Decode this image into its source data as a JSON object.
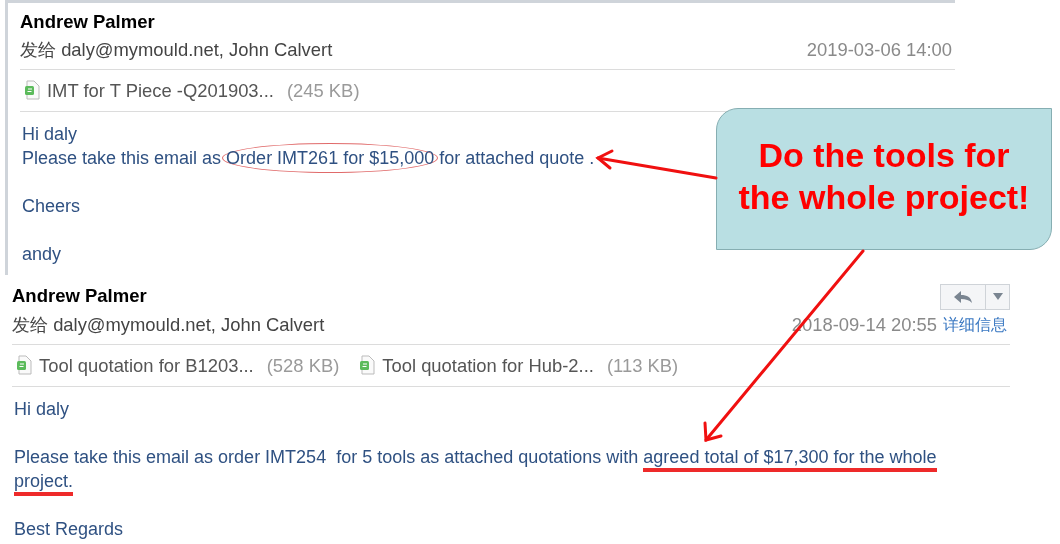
{
  "emails": [
    {
      "sender": "Andrew Palmer",
      "to_label": "发给",
      "recipients": "daly@mymould.net, John Calvert",
      "date": "2019-03-06 14:00",
      "attachments": [
        {
          "name": "IMT for T Piece -Q201903...",
          "size": "(245 KB)"
        }
      ],
      "paragraphs": [
        [
          [
            {
              "text": "Hi daly",
              "circled": false,
              "underlined": false
            }
          ],
          [
            {
              "text": "Please take this email as ",
              "circled": false,
              "underlined": false
            },
            {
              "text": "Order IMT261 for $15,000",
              "circled": true,
              "underlined": false
            },
            {
              "text": " for attached quote .",
              "circled": false,
              "underlined": false
            }
          ]
        ],
        [
          [
            {
              "text": "Cheers",
              "circled": false,
              "underlined": false
            }
          ]
        ],
        [
          [
            {
              "text": "andy",
              "circled": false,
              "underlined": false
            }
          ]
        ]
      ]
    },
    {
      "sender": "Andrew Palmer",
      "to_label": "发给",
      "recipients": "daly@mymould.net, John Calvert",
      "date": "2018-09-14 20:55",
      "details_link": "详细信息",
      "reply_buttons": true,
      "attachments": [
        {
          "name": "Tool quotation for B1203...",
          "size": "(528 KB)"
        },
        {
          "name": "Tool quotation for Hub-2...",
          "size": "(113 KB)"
        }
      ],
      "paragraphs": [
        [
          [
            {
              "text": "Hi daly",
              "circled": false,
              "underlined": false
            }
          ]
        ],
        [
          [
            {
              "text": "Please take this email as order IMT254  for 5 tools as attached quotations with ",
              "circled": false,
              "underlined": false
            },
            {
              "text": "agreed total of $17,300 for the whole",
              "circled": false,
              "underlined": true
            }
          ],
          [
            {
              "text": "project.",
              "circled": false,
              "underlined": true
            }
          ]
        ],
        [
          [
            {
              "text": "Best Regards",
              "circled": false,
              "underlined": false
            }
          ]
        ]
      ]
    }
  ],
  "callout": {
    "text": "Do the tools for the whole project!"
  }
}
